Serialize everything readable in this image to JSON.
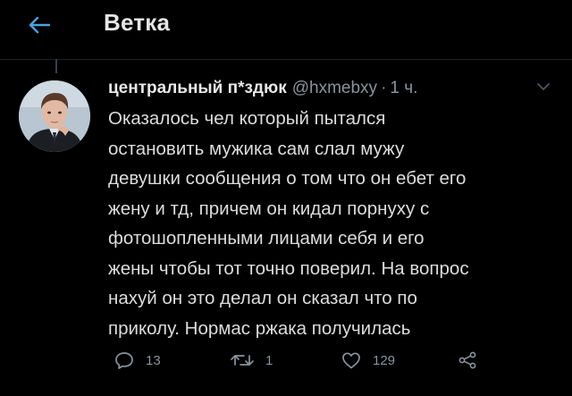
{
  "header": {
    "title": "Ветка",
    "back_icon": "arrow-left-icon",
    "accent_color": "#4aa3df"
  },
  "tweet": {
    "author_name": "центральный п*здюк",
    "handle": "@hxmebxy",
    "separator": "·",
    "time": "1 ч.",
    "lines": [
      "Оказалось чел который пытался",
      "остановить мужика сам слал мужу",
      "девушки сообщения о том что он ебет его",
      "жену и тд, причем он кидал порнуху с",
      "фотошопленными лицами себя и его",
      "жены чтобы тот точно поверил. На вопрос",
      "нахуй он это делал он сказал что по",
      "приколу. Нормас ржака получилась"
    ],
    "actions": {
      "reply_count": "13",
      "retweet_count": "1",
      "like_count": "129"
    }
  }
}
